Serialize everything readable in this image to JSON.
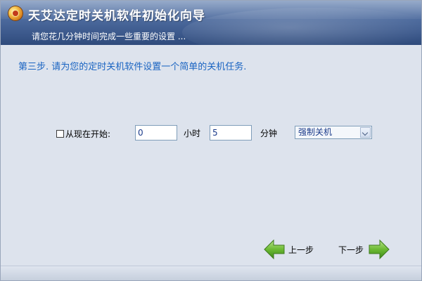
{
  "header": {
    "title": "天艾达定时关机软件初始化向导",
    "subtitle": "请您花几分钟时间完成一些重要的设置 ..."
  },
  "step": {
    "text": "第三步. 请为您的定时关机软件设置一个简单的关机任务."
  },
  "form": {
    "start_now_label": "从现在开始:",
    "start_now_checked": false,
    "hours_value": "0",
    "hours_unit": "小时",
    "minutes_value": "5",
    "minutes_unit": "分钟",
    "action_selected": "强制关机"
  },
  "nav": {
    "prev_label": "上一步",
    "next_label": "下一步"
  },
  "colors": {
    "header": "#3e5b8e",
    "accent_text": "#1a64c2",
    "arrow_green": "#5fae2e"
  }
}
